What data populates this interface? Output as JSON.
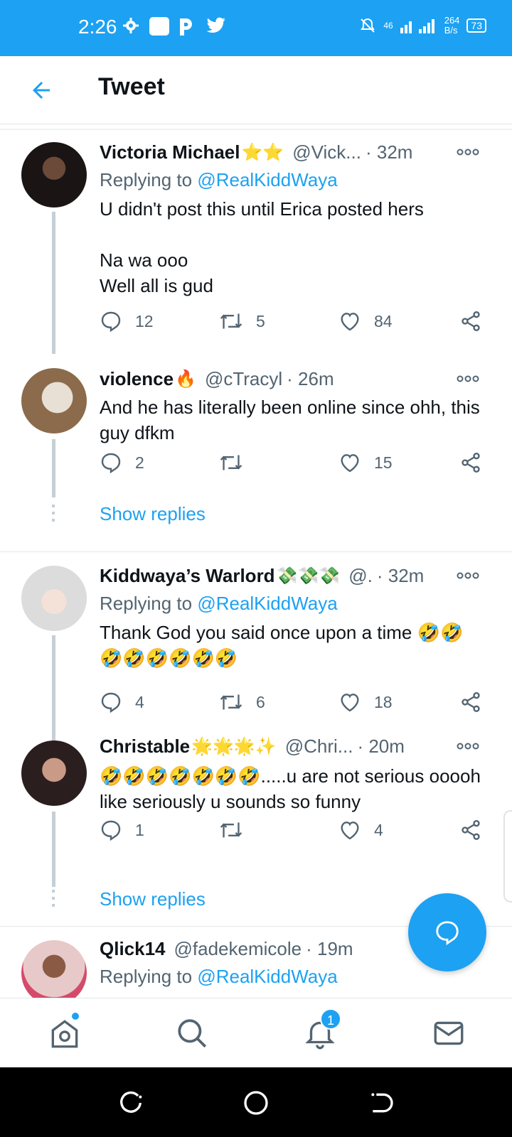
{
  "status_bar": {
    "time": "2:26",
    "network": "46",
    "speed_value": "264",
    "speed_unit": "B/s",
    "battery": "73"
  },
  "header": {
    "title": "Tweet"
  },
  "tweets": [
    {
      "name": "Victoria Michael",
      "name_emoji": "⭐⭐",
      "handle": "@Vick...",
      "time": "· 32m",
      "replying_label": "Replying to ",
      "replying_to": "@RealKiddWaya",
      "text": "U didn't post this until Erica posted hers\n\nNa wa ooo\nWell all is gud",
      "replies": "12",
      "retweets": "5",
      "likes": "84"
    },
    {
      "name": "violence",
      "name_emoji": "🔥",
      "handle": "@cTracyl",
      "time": "· 26m",
      "text": "And he has literally been online since ohh, this guy dfkm",
      "replies": "2",
      "retweets": "",
      "likes": "15",
      "show_replies": "Show replies"
    },
    {
      "name": "Kiddwaya’s Warlord",
      "name_emoji": "💸💸💸",
      "handle": "@.",
      "time": "· 32m",
      "replying_label": "Replying to ",
      "replying_to": "@RealKiddWaya",
      "text": "Thank God you said once upon a time 🤣🤣\n🤣🤣🤣🤣🤣🤣",
      "replies": "4",
      "retweets": "6",
      "likes": "18"
    },
    {
      "name": "Christable",
      "name_emoji": "🌟🌟🌟✨",
      "handle": "@Chri...",
      "time": "· 20m",
      "text": "🤣🤣🤣🤣🤣🤣🤣.....u are not serious ooooh like seriously u sounds so funny",
      "replies": "1",
      "retweets": "",
      "likes": "4",
      "show_replies": "Show replies"
    },
    {
      "name": "Qlick14",
      "name_emoji": "",
      "handle": "@fadekemicole",
      "time": "· 19m",
      "replying_label": "Replying to ",
      "replying_to": "@RealKiddWaya"
    }
  ],
  "bottom_nav": {
    "notifications_badge": "1"
  },
  "colors": {
    "accent": "#1da1f2",
    "secondary_text": "#536471",
    "thread_line": "#c4cfd6"
  }
}
